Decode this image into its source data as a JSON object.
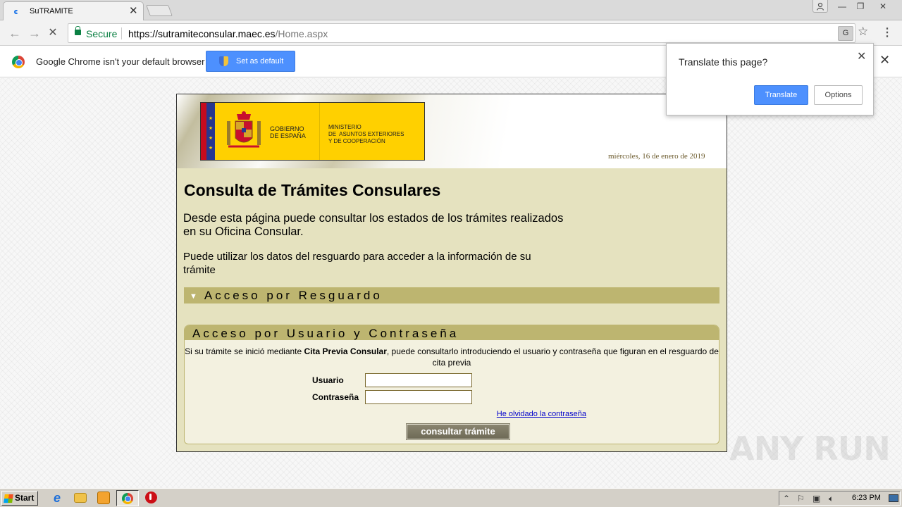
{
  "browser": {
    "tab_title": "SuTRAMITE",
    "tab_close": "✕",
    "url_secure_label": "Secure",
    "url_host": "https://sutramiteconsular.maec.es",
    "url_path": "/Home.aspx",
    "window_controls": {
      "minimize": "—",
      "maximize": "❐",
      "close": "✕"
    }
  },
  "infobar": {
    "message": "Google Chrome isn't your default browser",
    "set_default_label": "Set as default",
    "close": "✕"
  },
  "translate_popup": {
    "question": "Translate this page?",
    "translate_label": "Translate",
    "options_label": "Options",
    "close": "✕"
  },
  "page": {
    "gov_name_line1": "GOBIERNO",
    "gov_name_line2": "DE ESPAÑA",
    "ministry_line1": "MINISTERIO",
    "ministry_line2": "DE  ASUNTOS EXTERIORES",
    "ministry_line3": "Y DE COOPERACIÓN",
    "date": "miércoles, 16 de enero de 2019",
    "title": "Consulta de Trámites Consulares",
    "intro": "Desde esta página puede consultar los estados de los trámites realizados en su Oficina Consular.",
    "sub_intro": "Puede utilizar los datos del resguardo para acceder a la información de su trámite",
    "acc_resguardo_label": "Acceso por Resguardo",
    "login_heading": "Acceso por Usuario y Contraseña",
    "login_desc_pre": "Si su trámite se inició mediante ",
    "login_desc_bold": "Cita Previa Consular",
    "login_desc_post": ", puede consultarlo introduciendo el usuario y contraseña que figuran en el resguardo de cita previa",
    "user_label": "Usuario",
    "user_value": "",
    "password_label": "Contraseña",
    "password_value": "",
    "forgot_label": "He olvidado la contraseña",
    "submit_label": "consultar trámite"
  },
  "watermark": "ANY RUN",
  "taskbar": {
    "start_label": "Start",
    "clock": "6:23 PM"
  },
  "colors": {
    "panel_bg": "#e5e2bf",
    "section_bar": "#bdb570",
    "chrome_blue": "#4d90fe",
    "secure_green": "#0b8043"
  }
}
